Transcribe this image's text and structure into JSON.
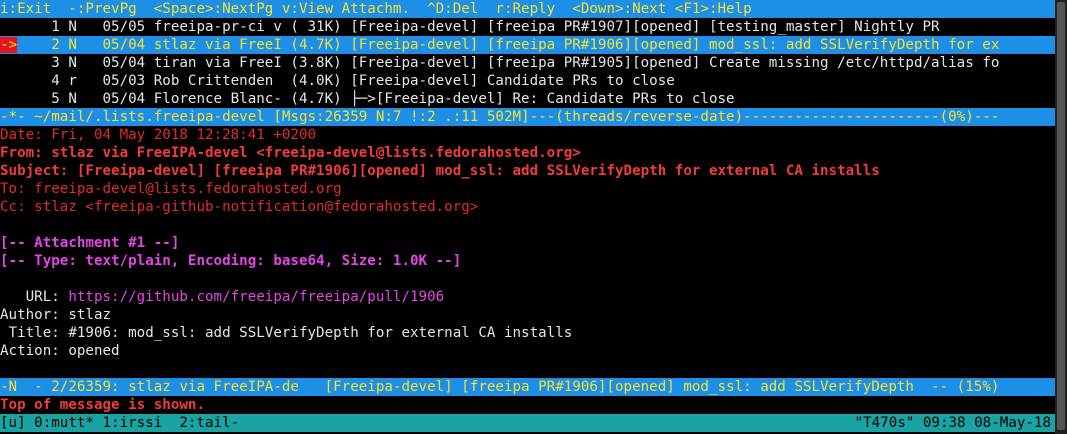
{
  "help_bar": "i:Exit  -:PrevPg  <Space>:NextPg v:View Attachm.  ^D:Del  r:Reply  <Down>:Next <F1>:Help",
  "index": [
    {
      "marker": "  ",
      "line": "    1 N   05/05 freeipa-pr-ci v ( 31K) [Freeipa-devel] [freeipa PR#1907][opened] [testing_master] Nightly PR"
    },
    {
      "marker": "->",
      "line": "    2 N   05/04 stlaz via FreeI (4.7K) [Freeipa-devel] [freeipa PR#1906][opened] mod_ssl: add SSLVerifyDepth for ex"
    },
    {
      "marker": "  ",
      "line": "    3 N   05/04 tiran via FreeI (3.8K) [Freeipa-devel] [freeipa PR#1905][opened] Create missing /etc/httpd/alias fo"
    },
    {
      "marker": "  ",
      "line": "    4 r   05/03 Rob Crittenden  (4.0K) [Freeipa-devel] Candidate PRs to close"
    },
    {
      "marker": "  ",
      "line": "    5 N   05/04 Florence Blanc- (4.7K) ├─>[Freeipa-devel] Re: Candidate PRs to close"
    }
  ],
  "index_status_bar": "-*- ~/mail/.lists.freeipa-devel [Msgs:26359 N:7 !:2 .:11 502M]---(threads/reverse-date)-----------------------(0%)---",
  "headers": {
    "date": "Date: Fri, 04 May 2018 12:28:41 +0200",
    "from": "From: stlaz via FreeIPA-devel <freeipa-devel@lists.fedorahosted.org>",
    "subject": "Subject: [Freeipa-devel] [freeipa PR#1906][opened] mod_ssl: add SSLVerifyDepth for external CA installs",
    "to": "To: freeipa-devel@lists.fedorahosted.org",
    "cc": "Cc: stlaz <freeipa-github-notification@fedorahosted.org>"
  },
  "attachment": {
    "title": "[-- Attachment #1 --]",
    "type": "[-- Type: text/plain, Encoding: base64, Size: 1.0K --]"
  },
  "body": {
    "url_label": "   URL: ",
    "url_value": "https://github.com/freeipa/freeipa/pull/1906",
    "author": "Author: stlaz",
    "title": " Title: #1906: mod_ssl: add SSLVerifyDepth for external CA installs",
    "action": "Action: opened"
  },
  "pager_status_bar": "-N  - 2/26359: stlaz via FreeIPA-de   [Freeipa-devel] [freeipa PR#1906][opened] mod_ssl: add SSLVerifyDepth  -- (15%)",
  "message_line": "Top of message is shown.",
  "tmux": {
    "left": "[u] 0:mutt* 1:irssi  2:tail-",
    "right": "\"T470s\" 09:38 08-May-18"
  },
  "colors": {
    "bar_blue": "#1d8fe6",
    "bar_text_yellow": "#f5e132",
    "header_red": "#e32a2a",
    "attachment_magenta": "#e645e6",
    "tmux_teal": "#19a3a3"
  }
}
